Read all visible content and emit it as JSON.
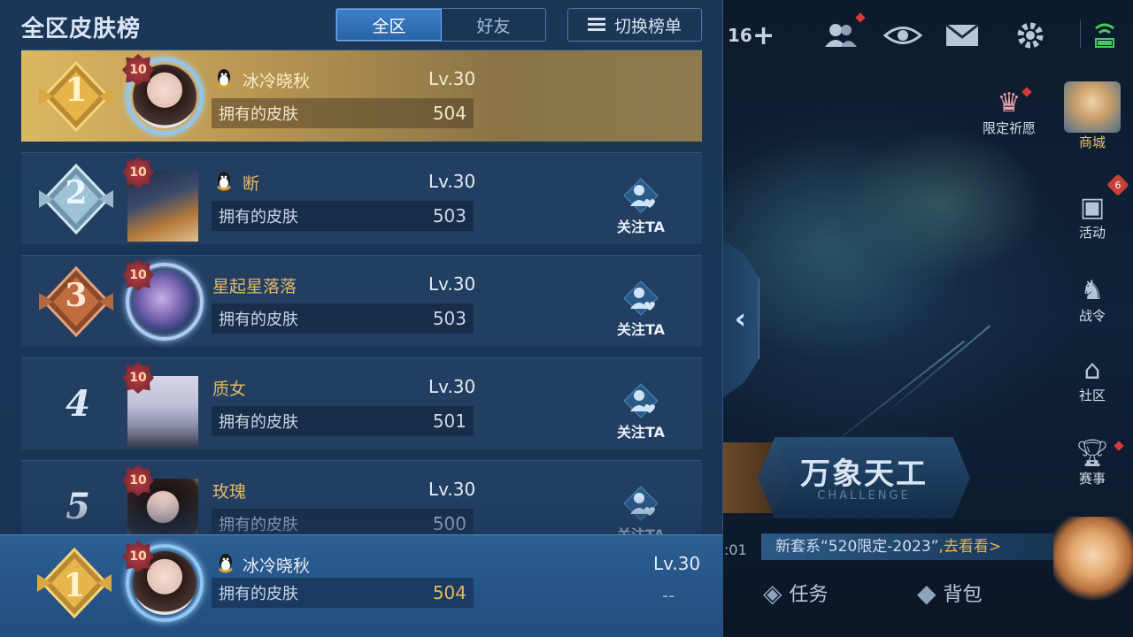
{
  "leaderboard": {
    "title": "全区皮肤榜",
    "tabs": [
      {
        "label": "全区",
        "active": true
      },
      {
        "label": "好友",
        "active": false
      }
    ],
    "switch_label": "切换榜单",
    "skin_label": "拥有的皮肤",
    "follow_label": "关注TA",
    "entries": [
      {
        "rank": "1",
        "name": "冰冷晓秋",
        "level": "Lv.30",
        "skins": "504",
        "qq_icon": true,
        "follow": false
      },
      {
        "rank": "2",
        "name": "断",
        "level": "Lv.30",
        "skins": "503",
        "qq_icon": true,
        "follow": true
      },
      {
        "rank": "3",
        "name": "星起星落落",
        "level": "Lv.30",
        "skins": "503",
        "qq_icon": false,
        "follow": true
      },
      {
        "rank": "4",
        "name": "质女",
        "level": "Lv.30",
        "skins": "501",
        "qq_icon": false,
        "follow": true
      },
      {
        "rank": "5",
        "name": "玫瑰",
        "level": "Lv.30",
        "skins": "500",
        "qq_icon": false,
        "follow": true
      }
    ],
    "frame_level": "10",
    "my_rank": {
      "rank": "1",
      "name": "冰冷晓秋",
      "level": "Lv.30",
      "skins": "504",
      "extra": "--"
    }
  },
  "lobby": {
    "friend_count": "16",
    "side_buttons": [
      {
        "label": "限定祈愿",
        "icon": "wish-icon"
      },
      {
        "label": "商城",
        "icon": "shop-icon"
      },
      {
        "label": "活动",
        "icon": "activity-icon",
        "badge": "6"
      },
      {
        "label": "战令",
        "icon": "battlepass-icon"
      },
      {
        "label": "社区",
        "icon": "community-icon"
      },
      {
        "label": "赛事",
        "icon": "trophy-icon"
      }
    ],
    "challenge": {
      "title": "万象天工",
      "subtitle": "CHALLENGE"
    },
    "timer": ":01",
    "notice": {
      "text": "新套系“520限定-2023”",
      "link": ",去看看>"
    },
    "bottom_buttons": [
      {
        "label": "任务",
        "icon": "task-icon"
      },
      {
        "label": "背包",
        "icon": "backpack-icon"
      }
    ]
  },
  "colors": {
    "panel_bg": "#1b3656",
    "gold_row": "#dcb862",
    "name_gold": "#e3b866",
    "accent_blue": "#3d7fc7",
    "skin_count_mine": "#e7b95c",
    "red_dot": "#d83a3a"
  }
}
